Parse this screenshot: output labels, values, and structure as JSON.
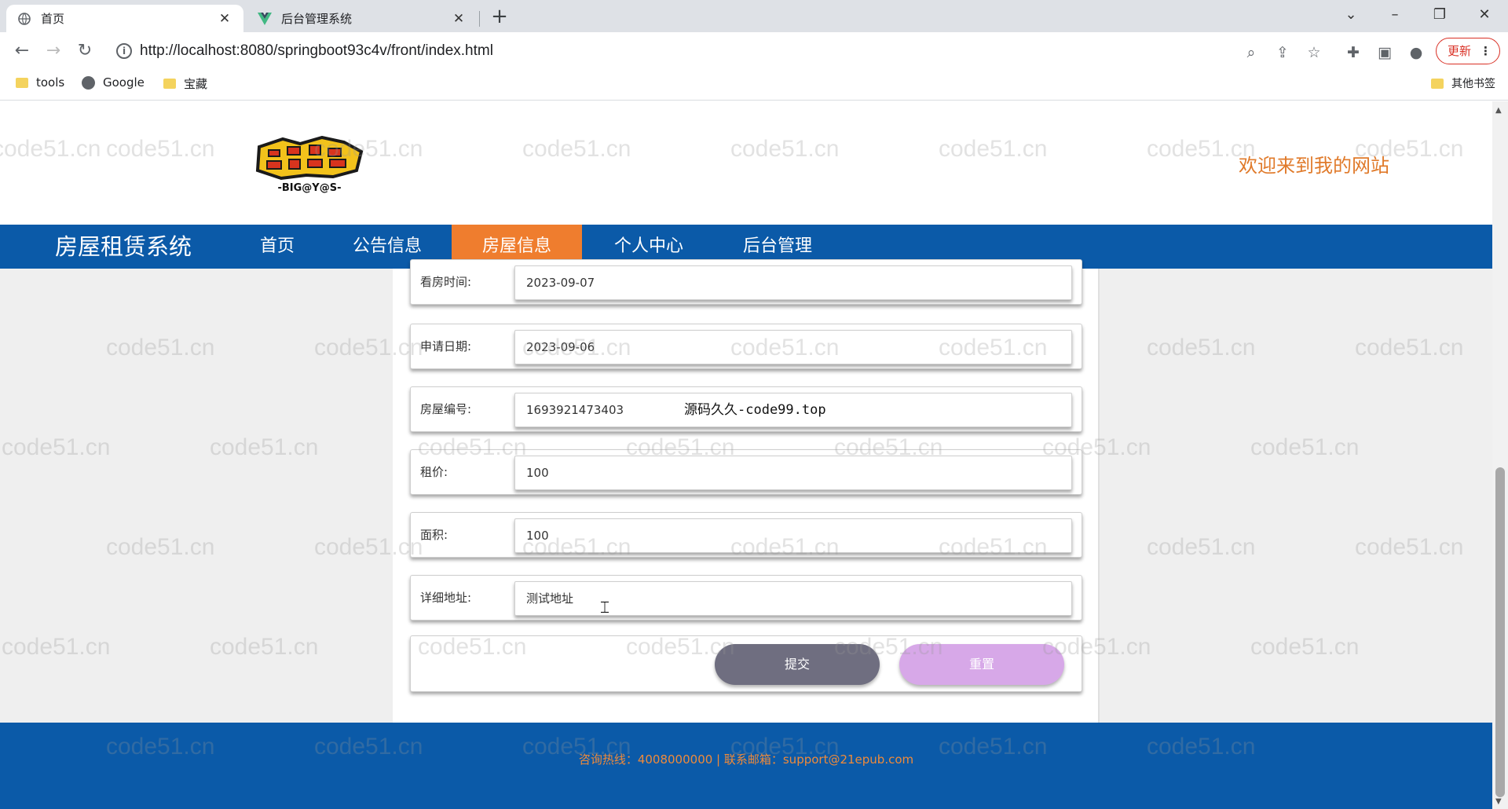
{
  "browser": {
    "tabs": [
      {
        "title": "首页",
        "active": true
      },
      {
        "title": "后台管理系统",
        "active": false
      }
    ],
    "url": "http://localhost:8080/springboot93c4v/front/index.html",
    "update_label": "更新",
    "bookmarks": [
      "tools",
      "Google",
      "宝藏"
    ],
    "other_bookmarks": "其他书签"
  },
  "header": {
    "welcome": "欢迎来到我的网站",
    "logo_text": "-BIG@Y@S-"
  },
  "nav": {
    "brand": "房屋租赁系统",
    "items": [
      "首页",
      "公告信息",
      "房屋信息",
      "个人中心",
      "后台管理"
    ],
    "active": "房屋信息"
  },
  "form": {
    "fields": [
      {
        "label": "看房时间:",
        "value": "2023-09-07"
      },
      {
        "label": "申请日期:",
        "value": "2023-09-06"
      },
      {
        "label": "房屋编号:",
        "value": "1693921473403"
      },
      {
        "label": "租价:",
        "value": "100"
      },
      {
        "label": "面积:",
        "value": "100"
      },
      {
        "label": "详细地址:",
        "value": "测试地址"
      }
    ],
    "overlay_text": "源码久久-code99.top",
    "submit_label": "提交",
    "reset_label": "重置"
  },
  "footer": {
    "text": "咨询热线：4008000000 | 联系邮箱：support@21epub.com"
  },
  "watermark": "code51.cn",
  "colors": {
    "nav_bg": "#0b5aa8",
    "nav_active": "#ef7d2e",
    "welcome": "#e07a2a",
    "footer_text": "#ef8a3a",
    "submit_btn": "#6f6e80",
    "reset_btn": "#d7a8e8"
  }
}
